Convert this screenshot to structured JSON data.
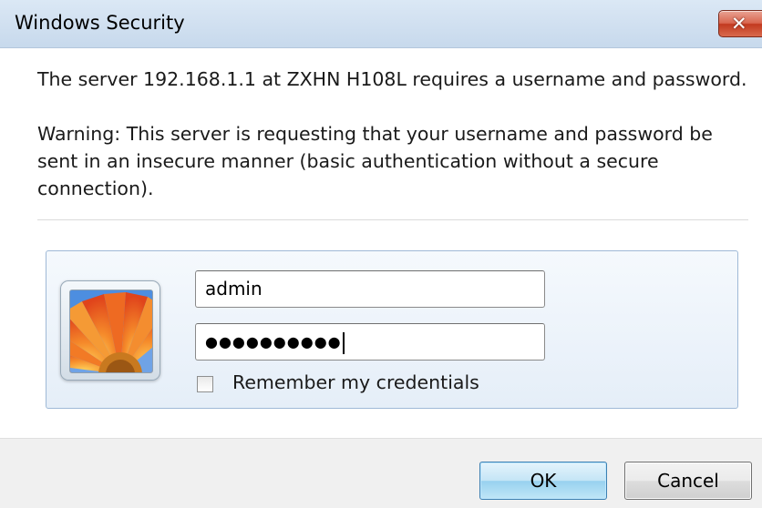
{
  "window": {
    "title": "Windows Security",
    "close_glyph": "✕"
  },
  "message": {
    "server_line": "The server 192.168.1.1 at ZXHN H108L requires a username and password.",
    "warning": "Warning: This server is requesting that your username and password be sent in an insecure manner (basic authentication without a secure connection)."
  },
  "credentials": {
    "username_value": "admin",
    "password_masked": "●●●●●●●●●●",
    "remember_label": "Remember my credentials",
    "remember_checked": false
  },
  "buttons": {
    "ok_label": "OK",
    "cancel_label": "Cancel"
  },
  "icons": {
    "close": "close-icon",
    "user_tile": "user-avatar-flower-icon",
    "checkbox": "checkbox-icon"
  },
  "colors": {
    "titlebar": "#d2e1f1",
    "close_button": "#c2391f",
    "panel": "#e5eef8",
    "ok_button": "#c4e5f6"
  }
}
